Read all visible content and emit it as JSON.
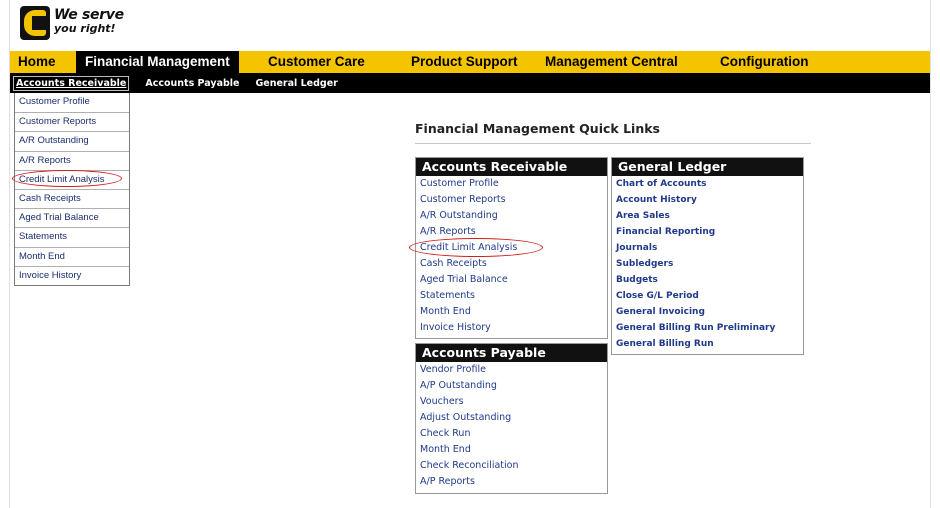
{
  "brand": {
    "logo_line1": "We serve",
    "logo_line2": "you right!",
    "accent_color": "#f5c400",
    "dark_color": "#000000",
    "link_color": "#1f3a8a",
    "highlight_color": "#d21e1e"
  },
  "main_nav": {
    "tabs": [
      {
        "label": "Home"
      },
      {
        "label": "Financial Management"
      },
      {
        "label": "Customer Care"
      },
      {
        "label": "Product Support"
      },
      {
        "label": "Management Central"
      },
      {
        "label": "Configuration"
      }
    ],
    "active": "Financial Management"
  },
  "sub_nav": {
    "items": [
      {
        "label": "Accounts Receivable"
      },
      {
        "label": "Accounts Payable"
      },
      {
        "label": "General Ledger"
      }
    ],
    "selected": "Accounts Receivable"
  },
  "dropdown": {
    "items": [
      {
        "label": "Customer Profile"
      },
      {
        "label": "Customer Reports"
      },
      {
        "label": "A/R Outstanding"
      },
      {
        "label": "A/R Reports"
      },
      {
        "label": "Credit Limit Analysis"
      },
      {
        "label": "Cash Receipts"
      },
      {
        "label": "Aged Trial Balance"
      },
      {
        "label": "Statements"
      },
      {
        "label": "Month End"
      },
      {
        "label": "Invoice History"
      }
    ],
    "highlighted": "Credit Limit Analysis"
  },
  "quick_links": {
    "title": "Financial Management Quick Links",
    "accounts_receivable": {
      "header": "Accounts Receivable",
      "links": [
        {
          "label": "Customer Profile"
        },
        {
          "label": "Customer Reports"
        },
        {
          "label": "A/R Outstanding"
        },
        {
          "label": "A/R Reports"
        },
        {
          "label": "Credit Limit Analysis"
        },
        {
          "label": "Cash Receipts"
        },
        {
          "label": "Aged Trial Balance"
        },
        {
          "label": "Statements"
        },
        {
          "label": "Month End"
        },
        {
          "label": "Invoice History"
        }
      ]
    },
    "accounts_payable": {
      "header": "Accounts Payable",
      "links": [
        {
          "label": "Vendor Profile"
        },
        {
          "label": "A/P Outstanding"
        },
        {
          "label": "Vouchers"
        },
        {
          "label": "Adjust Outstanding"
        },
        {
          "label": "Check Run"
        },
        {
          "label": "Month End"
        },
        {
          "label": "Check Reconciliation"
        },
        {
          "label": "A/P Reports"
        }
      ]
    },
    "general_ledger": {
      "header": "General Ledger",
      "links": [
        {
          "label": "Chart of Accounts"
        },
        {
          "label": "Account History"
        },
        {
          "label": "Area Sales"
        },
        {
          "label": "Financial Reporting"
        },
        {
          "label": "Journals"
        },
        {
          "label": "Subledgers"
        },
        {
          "label": "Budgets"
        },
        {
          "label": "Close G/L Period"
        },
        {
          "label": "General Invoicing"
        },
        {
          "label": "General Billing Run Preliminary"
        },
        {
          "label": "General Billing Run"
        }
      ]
    }
  }
}
